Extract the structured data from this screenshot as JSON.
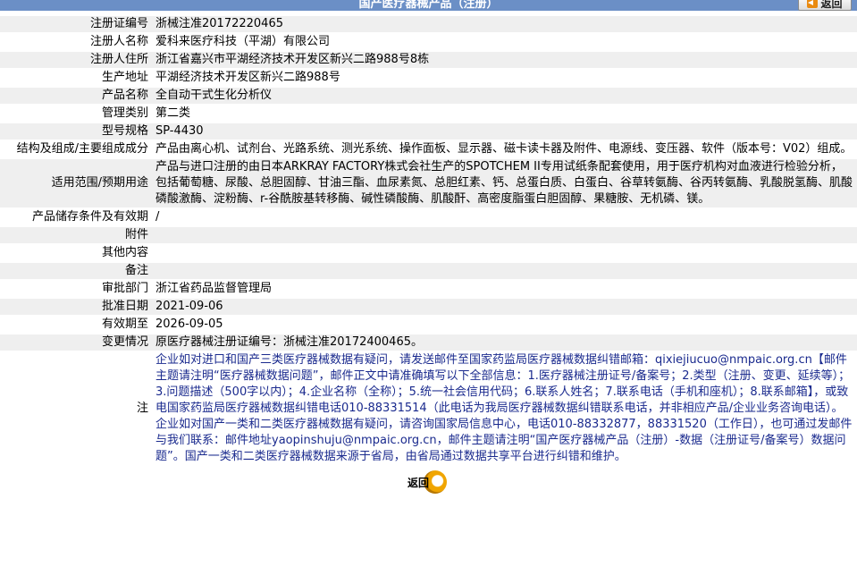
{
  "header": {
    "title": "国产医疗器械产品（注册）",
    "back_label": "返回"
  },
  "rows": [
    {
      "label": "注册证编号",
      "value": "浙械注准20172220465"
    },
    {
      "label": "注册人名称",
      "value": "爱科来医疗科技（平湖）有限公司"
    },
    {
      "label": "注册人住所",
      "value": "浙江省嘉兴市平湖经济技术开发区新兴二路988号8栋"
    },
    {
      "label": "生产地址",
      "value": "平湖经济技术开发区新兴二路988号"
    },
    {
      "label": "产品名称",
      "value": "全自动干式生化分析仪"
    },
    {
      "label": "管理类别",
      "value": "第二类"
    },
    {
      "label": "型号规格",
      "value": "SP-4430"
    },
    {
      "label": "结构及组成/主要组成成分",
      "value": "产品由离心机、试剂台、光路系统、测光系统、操作面板、显示器、磁卡读卡器及附件、电源线、变压器、软件（版本号：V02）组成。"
    },
    {
      "label": "适用范围/预期用途",
      "value": "产品与进口注册的由日本ARKRAY FACTORY株式会社生产的SPOTCHEM II专用试纸条配套使用，用于医疗机构对血液进行检验分析，包括葡萄糖、尿酸、总胆固醇、甘油三酯、血尿素氮、总胆红素、钙、总蛋白质、白蛋白、谷草转氨酶、谷丙转氨酶、乳酸脱氢酶、肌酸磷酸激酶、淀粉酶、r-谷酰胺基转移酶、碱性磷酸酶、肌酸酐、高密度脂蛋白胆固醇、果糖胺、无机磷、镁。"
    },
    {
      "label": "产品储存条件及有效期",
      "value": "/"
    },
    {
      "label": "附件",
      "value": ""
    },
    {
      "label": "其他内容",
      "value": ""
    },
    {
      "label": "备注",
      "value": ""
    },
    {
      "label": "审批部门",
      "value": "浙江省药品监督管理局"
    },
    {
      "label": "批准日期",
      "value": "2021-09-06"
    },
    {
      "label": "有效期至",
      "value": "2026-09-05"
    },
    {
      "label": "变更情况",
      "value": "原医疗器械注册证编号：浙械注准20172400465。"
    }
  ],
  "note": {
    "label": "注",
    "text": "企业如对进口和国产三类医疗器械数据有疑问，请发送邮件至国家药监局医疗器械数据纠错邮箱：qixiejiucuo@nmpaic.org.cn【邮件主题请注明“医疗器械数据问题”，邮件正文中请准确填写以下全部信息：1.医疗器械注册证号/备案号；2.类型（注册、变更、延续等）；3.问题描述（500字以内）；4.企业名称（全称）；5.统一社会信用代码；6.联系人姓名；7.联系电话（手机和座机）；8.联系邮箱】，或致电国家药监局医疗器械数据纠错电话010-88331514（此电话为我局医疗器械数据纠错联系电话，并非相应产品/企业业务咨询电话）。企业如对国产一类和二类医疗器械数据有疑问，请咨询国家局信息中心，电话010-88332877，88331520（工作日），也可通过发邮件与我们联系：邮件地址yaopinshuju@nmpaic.org.cn，邮件主题请注明“国产医疗器械产品（注册）-数据（注册证号/备案号）数据问题”。国产一类和二类医疗器械数据来源于省局，由省局通过数据共享平台进行纠错和维护。"
  },
  "bottom_back_label": "返回"
}
